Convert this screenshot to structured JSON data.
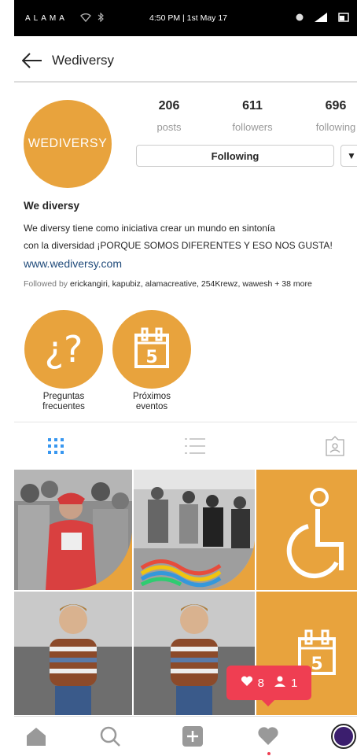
{
  "status_bar": {
    "carrier": "ALAMA",
    "time": "4:50 PM | 1st May 17"
  },
  "header": {
    "title": "Wediversy",
    "back_icon": "arrow-left-icon"
  },
  "profile": {
    "avatar_text": "WEDIVERSY",
    "stats": [
      {
        "value": "206",
        "label": "posts"
      },
      {
        "value": "611",
        "label": "followers"
      },
      {
        "value": "696",
        "label": "following"
      }
    ],
    "following_button": "Following",
    "dropdown_icon": "▼"
  },
  "bio": {
    "name": "We diversy",
    "line1": "We diversy tiene como iniciativa crear un mundo en sintonía",
    "line2": "con la diversidad ¡PORQUE SOMOS DIFERENTES Y ESO NOS GUSTA!",
    "website": "www.wediversy.com",
    "followed_prefix": "Followed by ",
    "followed_names": "erickangiri, kapubiz, alamacreative, 254Krewz, wawesh + 38 more"
  },
  "highlights": [
    {
      "line1": "Preguntas",
      "line2": "frecuentes",
      "icon": "question-icon"
    },
    {
      "line1": "Próximos",
      "line2": "eventos",
      "icon": "calendar-5-icon",
      "cal_number": "5"
    }
  ],
  "tabs": [
    {
      "name": "grid-view",
      "icon": "grid-icon",
      "active": true
    },
    {
      "name": "list-view",
      "icon": "list-icon",
      "active": false
    },
    {
      "name": "tagged-view",
      "icon": "tagged-person-icon",
      "active": false
    }
  ],
  "grid_tiles": [
    {
      "kind": "photo",
      "desc": "group-photo"
    },
    {
      "kind": "photo",
      "desc": "event-photo"
    },
    {
      "kind": "icon",
      "icon": "wheelchair-icon"
    },
    {
      "kind": "photo",
      "desc": "child-photo"
    },
    {
      "kind": "photo",
      "desc": "child-photo"
    },
    {
      "kind": "icon",
      "icon": "calendar-5-icon",
      "cal_number": "5"
    }
  ],
  "notification": {
    "likes": "8",
    "follows": "1"
  },
  "bottom_nav": [
    "home-icon",
    "search-icon",
    "add-post-icon",
    "activity-heart-icon",
    "profile-icon"
  ],
  "colors": {
    "brand_orange": "#e8a33d",
    "notification_red": "#ef3e52",
    "tab_active_blue": "#3897f0"
  }
}
